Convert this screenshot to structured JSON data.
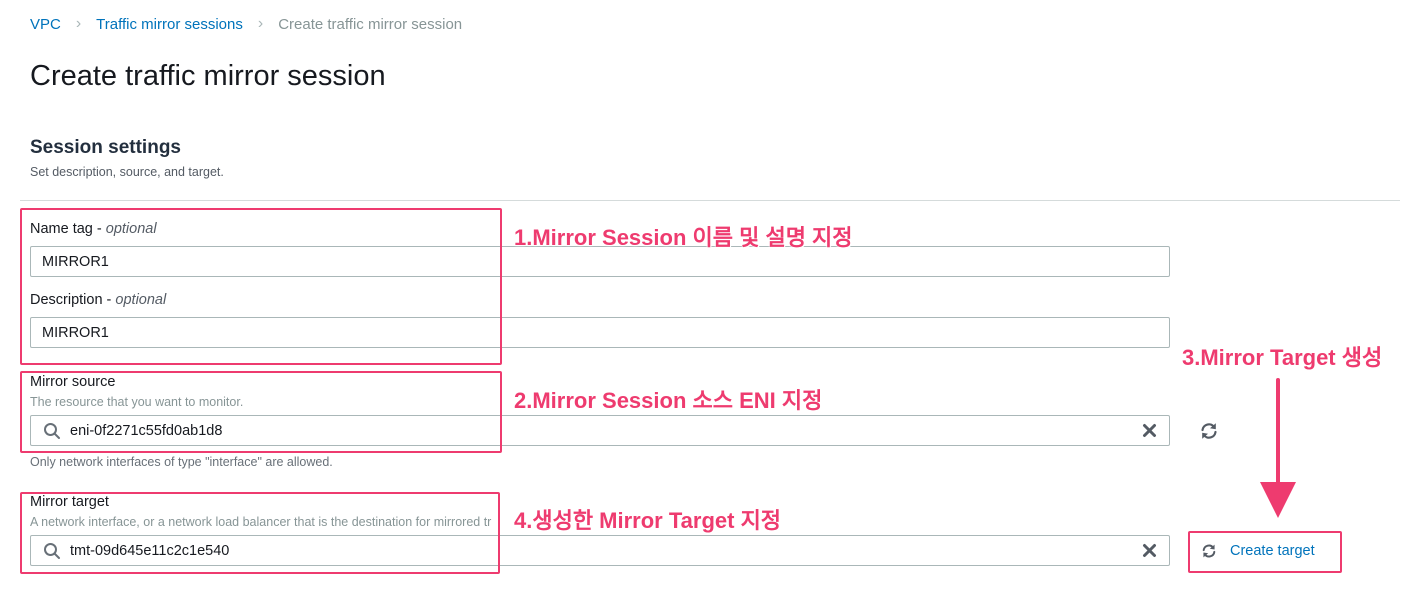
{
  "breadcrumb": {
    "items": [
      "VPC",
      "Traffic mirror sessions"
    ],
    "current": "Create traffic mirror session"
  },
  "page_title": "Create traffic mirror session",
  "section": {
    "title": "Session settings",
    "description": "Set description, source, and target."
  },
  "name_tag": {
    "label": "Name tag",
    "optional": "optional",
    "value": "MIRROR1"
  },
  "description_field": {
    "label": "Description",
    "optional": "optional",
    "value": "MIRROR1"
  },
  "mirror_source": {
    "label": "Mirror source",
    "description": "The resource that you want to monitor.",
    "value": "eni-0f2271c55fd0ab1d8",
    "constraint": "Only network interfaces of type \"interface\" are allowed."
  },
  "mirror_target": {
    "label": "Mirror target",
    "description": "A network interface, or a network load balancer that is the destination for mirrored tr",
    "value": "tmt-09d645e11c2c1e540",
    "create_label": "Create target"
  },
  "annotations": {
    "a1": "1.Mirror Session 이름 및 설명 지정",
    "a2": "2.Mirror Session 소스 ENI 지정",
    "a3": "3.Mirror Target 생성",
    "a4": "4.생성한 Mirror Target 지정"
  },
  "icons": [
    "chevron-right-icon",
    "search-icon",
    "clear-icon",
    "refresh-icon",
    "arrow-down-icon"
  ],
  "colors": {
    "link": "#0073bb",
    "annotation": "#ee3b6f",
    "text": "#16191f",
    "muted": "#879596",
    "border": "#aab7b8"
  }
}
